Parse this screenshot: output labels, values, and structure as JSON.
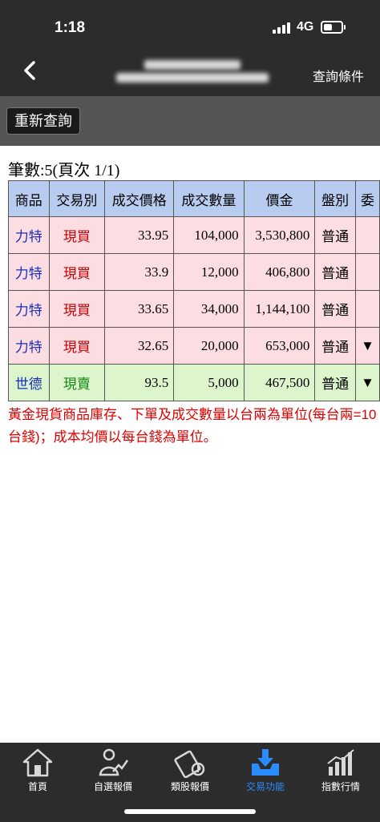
{
  "status": {
    "time": "1:18",
    "network": "4G"
  },
  "nav": {
    "query_conditions": "查詢條件"
  },
  "toolbar": {
    "requery_label": "重新查詢"
  },
  "summary": {
    "count_text": "筆數:5(頁次 1/1)"
  },
  "table": {
    "headers": [
      "商品",
      "交易別",
      "成交價格",
      "成交數量",
      "價金",
      "盤別",
      "委"
    ],
    "rows": [
      {
        "product": "力特",
        "side": "現買",
        "price": "33.95",
        "qty": "104,000",
        "amount": "3,530,800",
        "market": "普通",
        "extra": ""
      },
      {
        "product": "力特",
        "side": "現買",
        "price": "33.9",
        "qty": "12,000",
        "amount": "406,800",
        "market": "普通",
        "extra": ""
      },
      {
        "product": "力特",
        "side": "現買",
        "price": "33.65",
        "qty": "34,000",
        "amount": "1,144,100",
        "market": "普通",
        "extra": ""
      },
      {
        "product": "力特",
        "side": "現買",
        "price": "32.65",
        "qty": "20,000",
        "amount": "653,000",
        "market": "普通",
        "extra": "▼"
      },
      {
        "product": "世德",
        "side": "現賣",
        "price": "93.5",
        "qty": "5,000",
        "amount": "467,500",
        "market": "普通",
        "extra": "▼"
      }
    ]
  },
  "note": "黃金現貨商品庫存、下單及成交數量以台兩為單位(每台兩=10台錢)；成本均價以每台錢為單位。",
  "tabs": [
    {
      "label": "首頁",
      "icon": "home-icon"
    },
    {
      "label": "自選報價",
      "icon": "favorite-quote-icon"
    },
    {
      "label": "類股報價",
      "icon": "sector-quote-icon"
    },
    {
      "label": "交易功能",
      "icon": "trade-icon",
      "active": true
    },
    {
      "label": "指數行情",
      "icon": "index-chart-icon"
    }
  ],
  "colors": {
    "accent": "#2b8cff",
    "header_bg": "#2c2c2c",
    "buy_row": "#fcdde2",
    "sell_row": "#dcf5cc",
    "note": "#e00000"
  }
}
